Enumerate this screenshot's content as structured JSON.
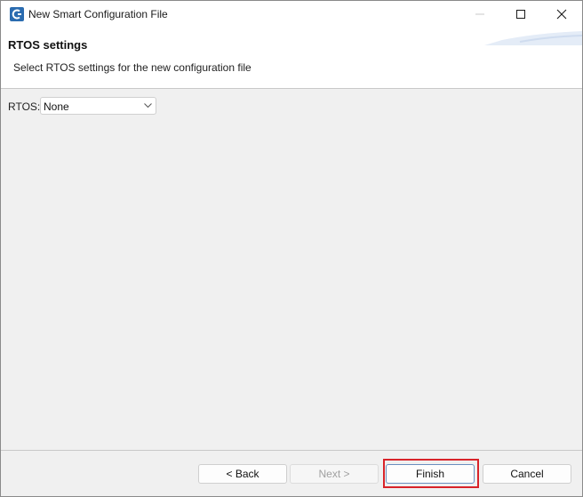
{
  "window": {
    "title": "New Smart Configuration File",
    "app_icon": "renesas-e2-studio-icon",
    "controls": {
      "minimize_icon": "minimize-icon",
      "maximize_icon": "maximize-icon",
      "close_icon": "close-icon"
    }
  },
  "header": {
    "title": "RTOS settings",
    "description": "Select RTOS settings for the new configuration file"
  },
  "form": {
    "rtos_label": "RTOS:",
    "rtos_value": "None"
  },
  "buttons": {
    "back": "< Back",
    "next": "Next >",
    "finish": "Finish",
    "cancel": "Cancel"
  },
  "highlight": {
    "target": "finish-button",
    "color": "#d8232a"
  }
}
